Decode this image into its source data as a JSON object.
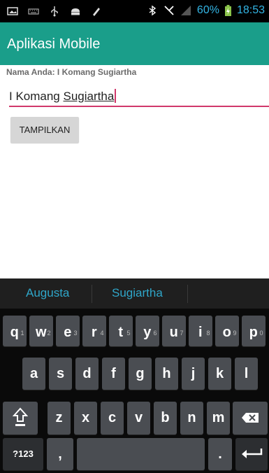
{
  "status_bar": {
    "battery_percent": "60%",
    "time": "18:53",
    "icons_left": [
      "image-icon",
      "keyboard-icon",
      "usb-icon",
      "android-icon",
      "pen-icon"
    ],
    "icons_right": [
      "bluetooth-icon",
      "mute-icon",
      "signal-icon",
      "battery-charging-icon"
    ]
  },
  "app": {
    "title": "Aplikasi Mobile"
  },
  "form": {
    "label": "Nama Anda: I Komang Sugiartha",
    "input_value_plain": "I Komang ",
    "input_value_underlined": "Sugiartha",
    "button_label": "TAMPILKAN"
  },
  "keyboard": {
    "suggestions": [
      "Augusta",
      "Sugiartha"
    ],
    "row1": [
      {
        "key": "q",
        "hint": "1"
      },
      {
        "key": "w",
        "hint": "2"
      },
      {
        "key": "e",
        "hint": "3"
      },
      {
        "key": "r",
        "hint": "4"
      },
      {
        "key": "t",
        "hint": "5"
      },
      {
        "key": "y",
        "hint": "6"
      },
      {
        "key": "u",
        "hint": "7"
      },
      {
        "key": "i",
        "hint": "8"
      },
      {
        "key": "o",
        "hint": "9"
      },
      {
        "key": "p",
        "hint": "0"
      }
    ],
    "row2": [
      "a",
      "s",
      "d",
      "f",
      "g",
      "h",
      "j",
      "k",
      "l"
    ],
    "row3": [
      "z",
      "x",
      "c",
      "v",
      "b",
      "n",
      "m"
    ],
    "symbols_label": "?123",
    "comma": ",",
    "period": "."
  }
}
